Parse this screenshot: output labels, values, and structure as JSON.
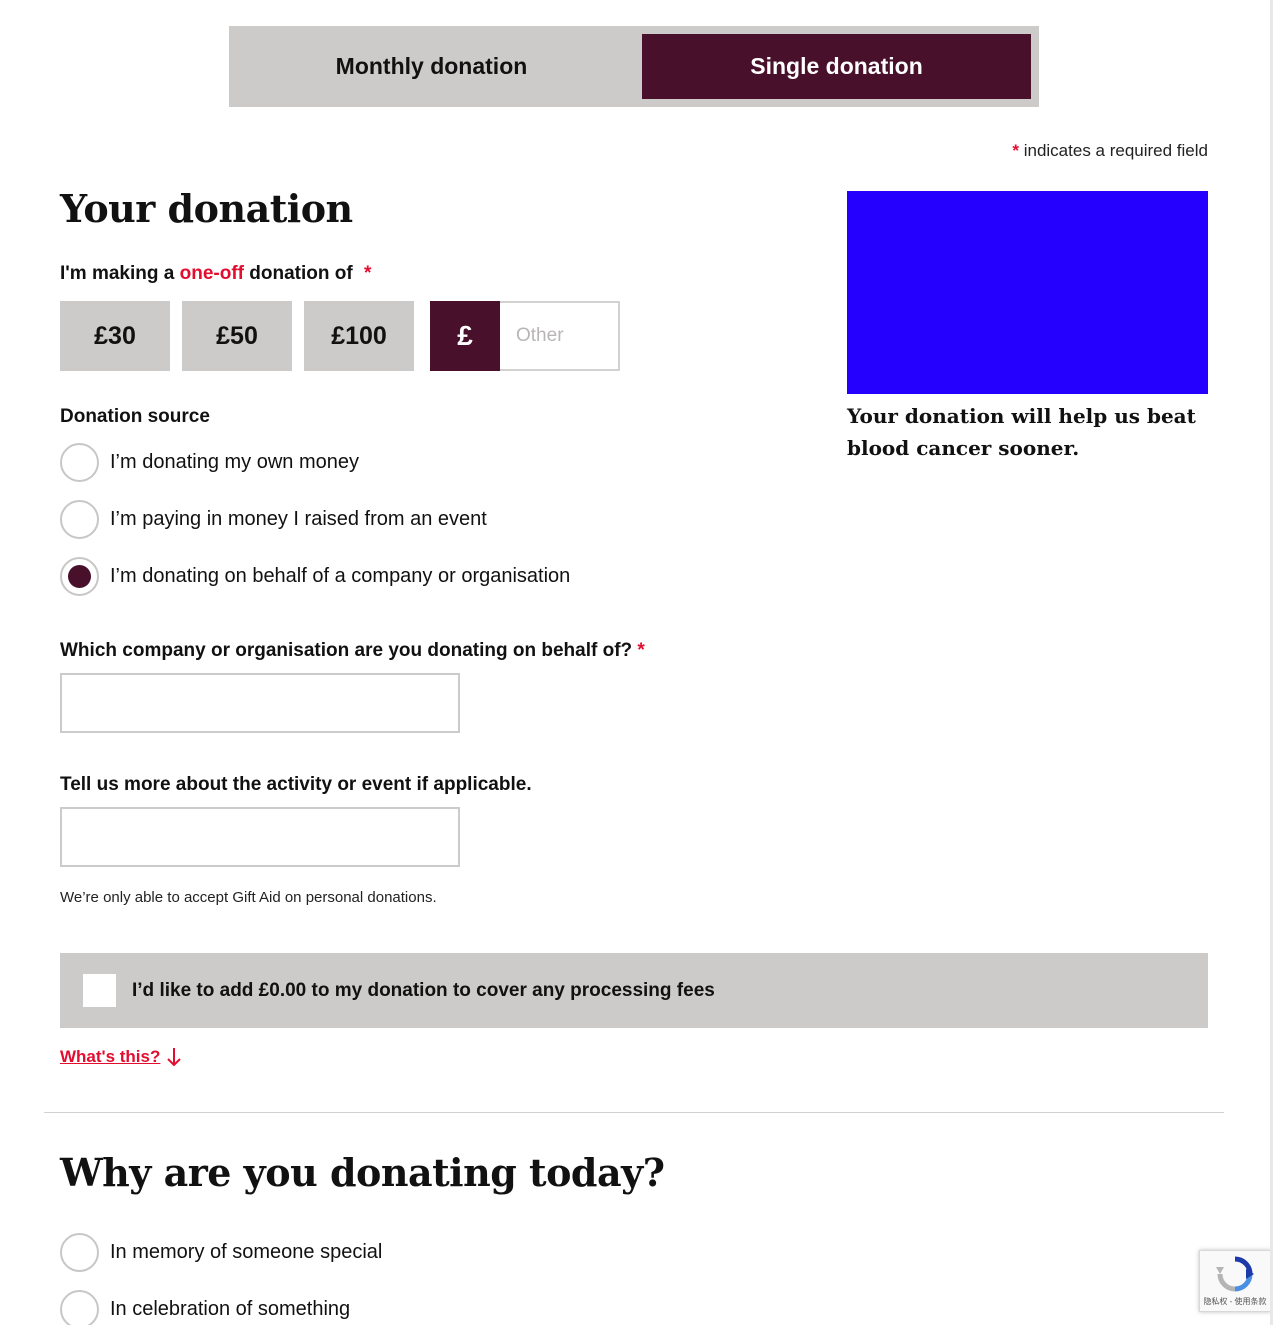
{
  "toggle": {
    "monthly_label": "Monthly donation",
    "single_label": "Single donation",
    "selected": "Single donation"
  },
  "required_note": {
    "star": "*",
    "text": "indicates a required field"
  },
  "your_donation": {
    "heading": "Your donation",
    "amount_label_pre": "I'm making a",
    "amount_label_accent": "one-off",
    "amount_label_post": "donation of",
    "required_star": "*",
    "amounts": [
      "£30",
      "£50",
      "£100"
    ],
    "currency_symbol": "£",
    "other_placeholder": "Other",
    "other_value": ""
  },
  "donation_source": {
    "label": "Donation source",
    "options": [
      {
        "label": "I’m donating my own money",
        "selected": false
      },
      {
        "label": "I’m paying in money I raised from an event",
        "selected": false
      },
      {
        "label": "I’m donating on behalf of a company or organisation",
        "selected": true
      }
    ]
  },
  "company_field": {
    "label": "Which company or organisation are you donating on behalf of?",
    "required_star": "*",
    "value": ""
  },
  "activity_field": {
    "label": "Tell us more about the activity or event if applicable.",
    "value": ""
  },
  "gift_aid_note": "We’re only able to accept Gift Aid on personal donations.",
  "processing_fees": {
    "label": "I’d like to add £0.00 to my donation to cover any processing fees",
    "checked": false
  },
  "whats_this": "What's this?",
  "why_donating": {
    "heading": "Why are you donating today?",
    "options": [
      {
        "label": "In memory of someone special",
        "selected": false
      },
      {
        "label": "In celebration of something",
        "selected": false
      }
    ]
  },
  "promo": {
    "text": "Your donation will help us beat blood cancer sooner."
  },
  "recaptcha": {
    "links": "隐私权 - 使用条款"
  },
  "colors": {
    "brand": "#48102a",
    "accent": "#e30d2f",
    "panel_grey": "#cdcbca",
    "promo_blue": "#2600ff"
  }
}
